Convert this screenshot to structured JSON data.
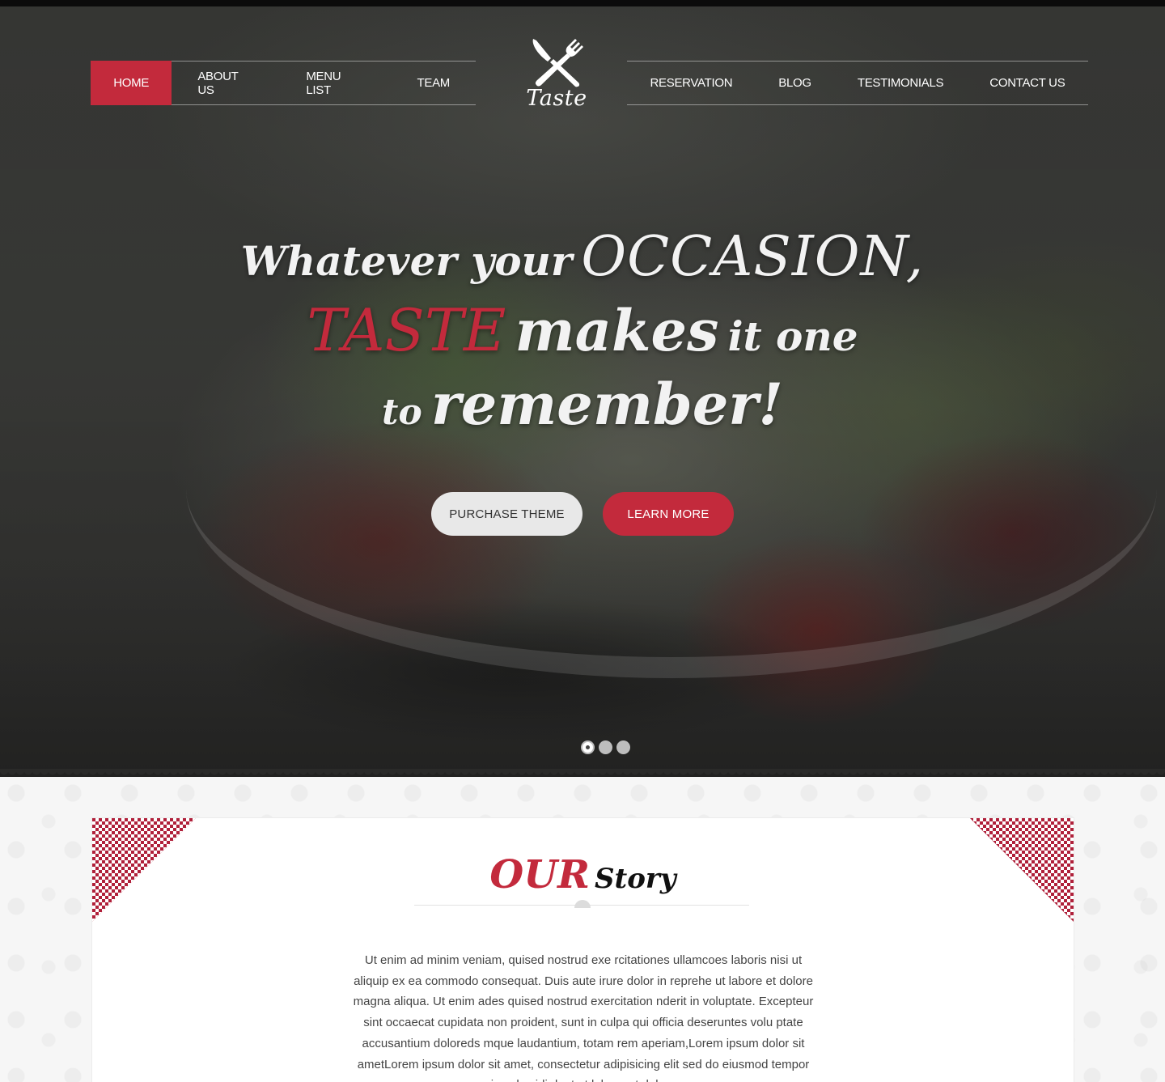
{
  "nav": {
    "left": [
      "HOME",
      "ABOUT US",
      "MENU LIST",
      "TEAM"
    ],
    "right": [
      "RESERVATION",
      "BLOG",
      "TESTIMONIALS",
      "CONTACT US"
    ],
    "active": "HOME"
  },
  "logo": {
    "text": "Taste",
    "icon": "fork-knife-icon"
  },
  "hero": {
    "line1_a": "Whatever your",
    "line1_b": "OCCASION,",
    "line2_a": "TASTE",
    "line2_b": "makes",
    "line2_c": "it one",
    "line3_a": "to",
    "line3_b": "remember!",
    "buttons": {
      "primary": "PURCHASE THEME",
      "secondary": "LEARN MORE"
    },
    "slides": {
      "count": 3,
      "active": 1
    }
  },
  "story": {
    "title_a": "OUR",
    "title_b": "Story",
    "body": "Ut enim ad minim veniam, quised nostrud exe rcitationes ullamcoes laboris nisi ut aliquip ex ea commodo consequat. Duis aute irure dolor in reprehe ut labore et dolore magna aliqua. Ut enim ades quised nostrud exercitation nderit in voluptate. Excepteur sint occaecat cupidata non proident, sunt in culpa qui officia deseruntes volu ptate accusantium doloreds mque laudantium, totam rem aperiam,Lorem ipsum dolor sit ametLorem ipsum dolor sit amet, consectetur adipisicing elit sed do eiusmod tempor in cubscidi dunt ut labore et dolore"
  },
  "colors": {
    "accent": "#c32a3c",
    "text": "#444444",
    "nav_text": "#ffffff"
  }
}
